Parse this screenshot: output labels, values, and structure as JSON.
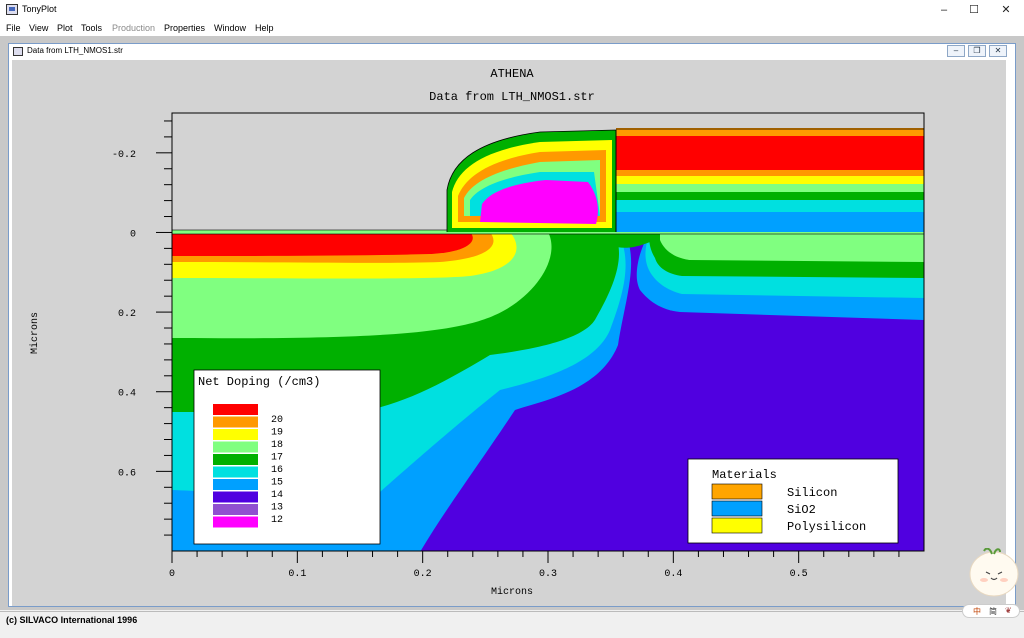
{
  "window": {
    "title": "TonyPlot",
    "minimize": "–",
    "maximize": "☐",
    "close": "✕"
  },
  "menu": [
    {
      "label": "File",
      "enabled": true
    },
    {
      "label": "View",
      "enabled": true
    },
    {
      "label": "Plot",
      "enabled": true
    },
    {
      "label": "Tools",
      "enabled": true
    },
    {
      "label": "Production",
      "enabled": false
    },
    {
      "label": "Properties",
      "enabled": true
    },
    {
      "label": "Window",
      "enabled": true
    },
    {
      "label": "Help",
      "enabled": true
    }
  ],
  "child_window": {
    "title": "Data from LTH_NMOS1.str",
    "minimize": "–",
    "restore": "❐",
    "close": "✕"
  },
  "plot": {
    "title": "ATHENA",
    "subtitle": "Data from LTH_NMOS1.str",
    "xlabel": "Microns",
    "ylabel": "Microns",
    "x_ticks": [
      "0",
      "0.1",
      "0.2",
      "0.3",
      "0.4",
      "0.5"
    ],
    "y_ticks": [
      "-0.2",
      "0",
      "0.2",
      "0.4",
      "0.6"
    ],
    "doping_legend": {
      "title": "Net Doping (/cm3)",
      "levels": [
        {
          "label": "20",
          "color": "#ff0000"
        },
        {
          "label": "19",
          "color": "#ff9900"
        },
        {
          "label": "18",
          "color": "#ffff00"
        },
        {
          "label": "17",
          "color": "#80ff80"
        },
        {
          "label": "16",
          "color": "#00b000"
        },
        {
          "label": "15",
          "color": "#00e0e0"
        },
        {
          "label": "14",
          "color": "#00a0ff"
        },
        {
          "label": "13",
          "color": "#5000e0"
        },
        {
          "label": "12",
          "color": "#9050d0"
        },
        {
          "label": "",
          "color": "#ff00ff"
        }
      ]
    },
    "materials_legend": {
      "title": "Materials",
      "items": [
        {
          "label": "Silicon",
          "color": "#ffa500"
        },
        {
          "label": "SiO2",
          "color": "#00a0ff"
        },
        {
          "label": "Polysilicon",
          "color": "#ffff00"
        }
      ]
    }
  },
  "chart_data": {
    "type": "heatmap",
    "title": "ATHENA",
    "subtitle": "Data from LTH_NMOS1.str",
    "xlabel": "Microns",
    "ylabel": "Microns",
    "xlim": [
      0,
      0.6
    ],
    "ylim": [
      0.8,
      -0.3
    ],
    "x_ticks": [
      0,
      0.1,
      0.2,
      0.3,
      0.4,
      0.5
    ],
    "y_ticks": [
      -0.2,
      0,
      0.2,
      0.4,
      0.6
    ],
    "quantity": "Net Doping (/cm3)",
    "levels": [
      20,
      19,
      18,
      17,
      16,
      15,
      14,
      13,
      12
    ],
    "materials": [
      "Silicon",
      "SiO2",
      "Polysilicon"
    ]
  },
  "status": {
    "text": "(c) SILVACO International 1996"
  },
  "ime": {
    "char1": "中",
    "char2": "简",
    "char3": "❦"
  }
}
